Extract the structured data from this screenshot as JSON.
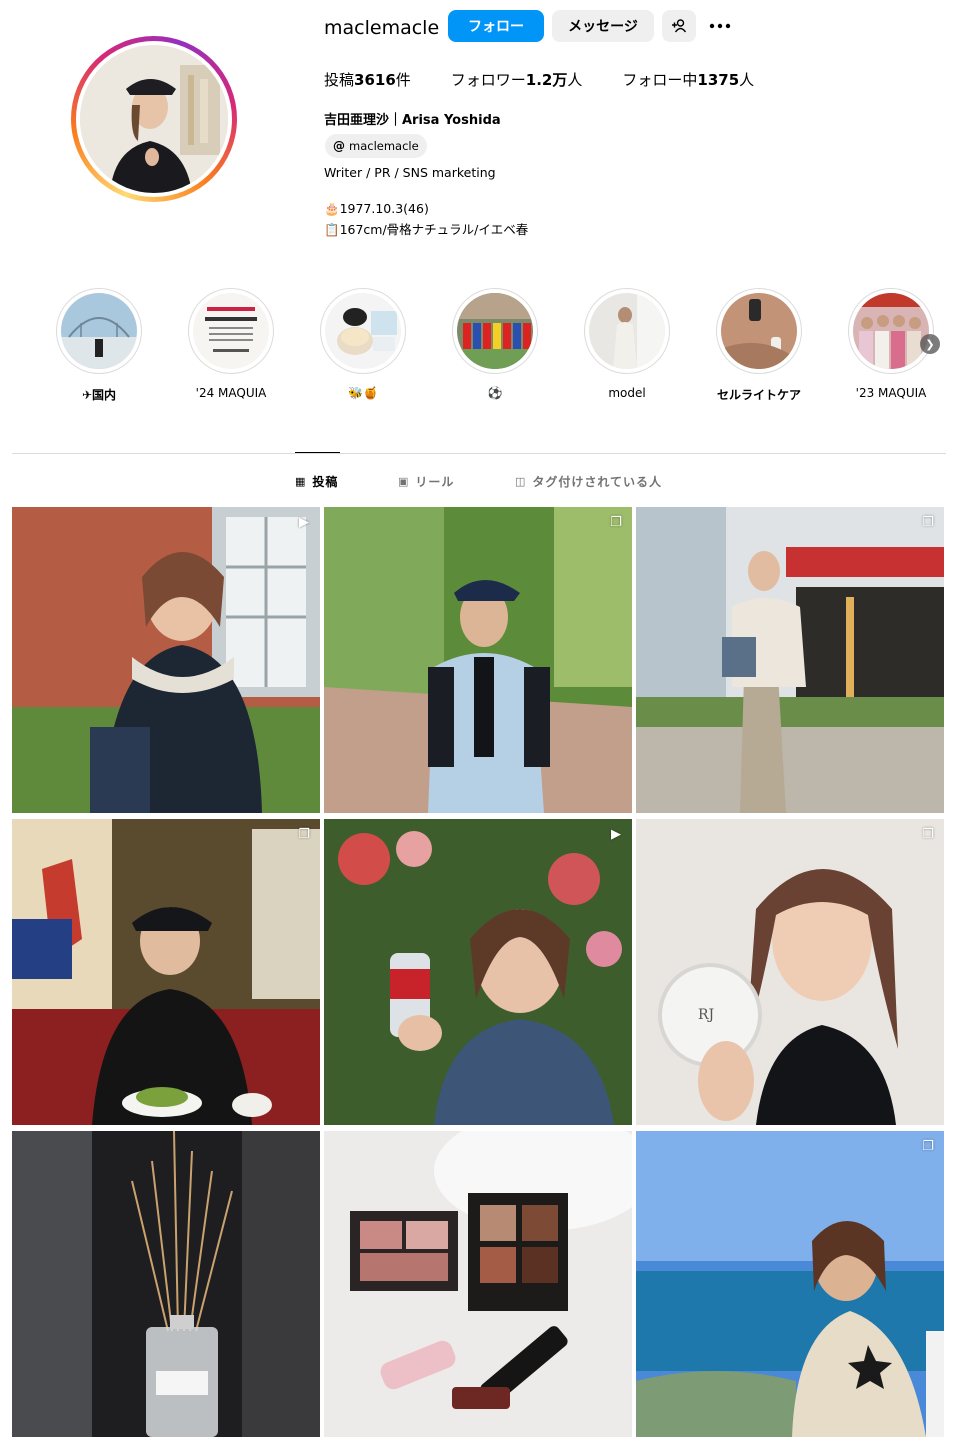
{
  "profile": {
    "username": "maclemacle",
    "follow_label": "フォロー",
    "message_label": "メッセージ",
    "add_user_icon": "add-user-icon",
    "more_icon": "more-options-icon",
    "stats": {
      "posts_prefix": "投稿",
      "posts_value": "3616",
      "posts_suffix": "件",
      "followers_prefix": "フォロワー",
      "followers_value": "1.2万",
      "followers_suffix": "人",
      "following_prefix": "フォロー中",
      "following_value": "1375",
      "following_suffix": "人"
    },
    "full_name": "吉田亜理沙｜Arisa Yoshida",
    "threads_handle": "maclemacle",
    "bio": {
      "line1": "Writer / PR / SNS marketing",
      "line2": "🎂1977.10.3(46)",
      "line3": "📋167cm/骨格ナチュラル/イエベ春"
    }
  },
  "highlights": [
    {
      "label": "✈国内"
    },
    {
      "label": "'24 MAQUIA"
    },
    {
      "label": "🐝🍯"
    },
    {
      "label": "⚽"
    },
    {
      "label": "model"
    },
    {
      "label": "セルライトケア"
    },
    {
      "label": "'23 MAQUIA"
    }
  ],
  "tabs": {
    "posts": "投稿",
    "reels": "リール",
    "tagged": "タグ付けされている人"
  },
  "colors": {
    "accent": "#0095f6",
    "button_gray": "#efefef",
    "divider": "#dbdbdb"
  },
  "posts": [
    {
      "badge": "reel-icon"
    },
    {
      "badge": "carousel-icon"
    },
    {
      "badge": "carousel-icon"
    },
    {
      "badge": "carousel-icon"
    },
    {
      "badge": "reel-icon"
    },
    {
      "badge": "carousel-icon"
    },
    {
      "badge": ""
    },
    {
      "badge": ""
    },
    {
      "badge": "carousel-icon"
    }
  ]
}
